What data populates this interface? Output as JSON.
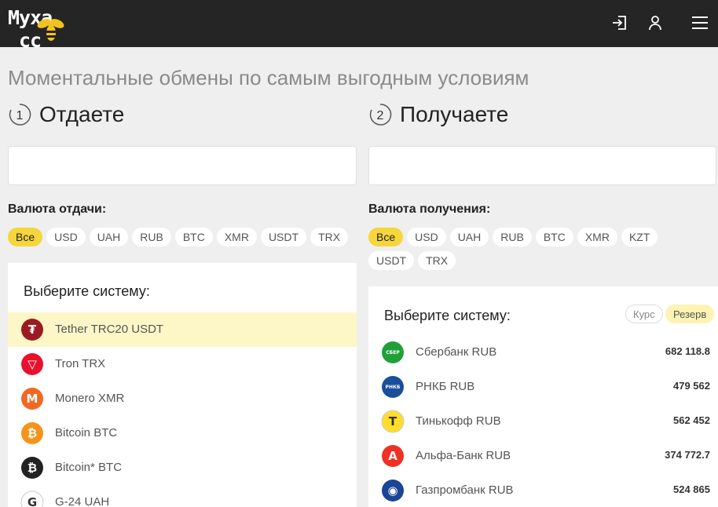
{
  "header": {
    "logo_text": "Myxa",
    "logo_suffix": "cc",
    "icons": [
      "login-icon",
      "user-icon",
      "menu-icon"
    ]
  },
  "page_title": "Моментальные обмены по самым выгодным условиям",
  "give": {
    "step_number": "1",
    "step_label": "Отдаете",
    "currency_label": "Валюта отдачи:",
    "chips": [
      "Все",
      "USD",
      "UAH",
      "RUB",
      "BTC",
      "XMR",
      "USDT",
      "TRX"
    ],
    "panel_title": "Выберите систему:",
    "systems": [
      {
        "name": "Tether TRC20 USDT",
        "icon": "tether-icon",
        "color": "#9b1b20",
        "glyph": "₮"
      },
      {
        "name": "Tron TRX",
        "icon": "tron-icon",
        "color": "#e8112d",
        "glyph": "▽"
      },
      {
        "name": "Monero XMR",
        "icon": "monero-icon",
        "color": "#f26822",
        "glyph": "M"
      },
      {
        "name": "Bitcoin BTC",
        "icon": "bitcoin-icon",
        "color": "#f7931a",
        "glyph": "₿"
      },
      {
        "name": "Bitcoin* BTC",
        "icon": "bitcoin-dark-icon",
        "color": "#222222",
        "glyph": "₿"
      },
      {
        "name": "G-24 UAH",
        "icon": "g24-icon",
        "color": "#ffffff",
        "glyph": "G"
      }
    ]
  },
  "get": {
    "step_number": "2",
    "step_label": "Получаете",
    "currency_label": "Валюта получения:",
    "chips": [
      "Все",
      "USD",
      "UAH",
      "RUB",
      "BTC",
      "XMR",
      "KZT",
      "USDT",
      "TRX"
    ],
    "panel_title": "Выберите систему:",
    "sort": {
      "rate": "Курс",
      "reserve": "Резерв"
    },
    "systems": [
      {
        "name": "Сбербанк RUB",
        "icon": "sberbank-icon",
        "amount": "682 118.8",
        "color": "#21a038",
        "glyph": "СБЕР"
      },
      {
        "name": "РНКБ RUB",
        "icon": "rnkb-icon",
        "amount": "479 562",
        "color": "#1a4f9c",
        "glyph": "РНКБ"
      },
      {
        "name": "Тинькофф RUB",
        "icon": "tinkoff-icon",
        "amount": "562 452",
        "color": "#ffdd2d",
        "glyph": "Т"
      },
      {
        "name": "Альфа-Банк RUB",
        "icon": "alfabank-icon",
        "amount": "374 772.7",
        "color": "#ef3124",
        "glyph": "А"
      },
      {
        "name": "Газпромбанк RUB",
        "icon": "gazprombank-icon",
        "amount": "524 865",
        "color": "#1b4595",
        "glyph": "◉"
      }
    ]
  }
}
